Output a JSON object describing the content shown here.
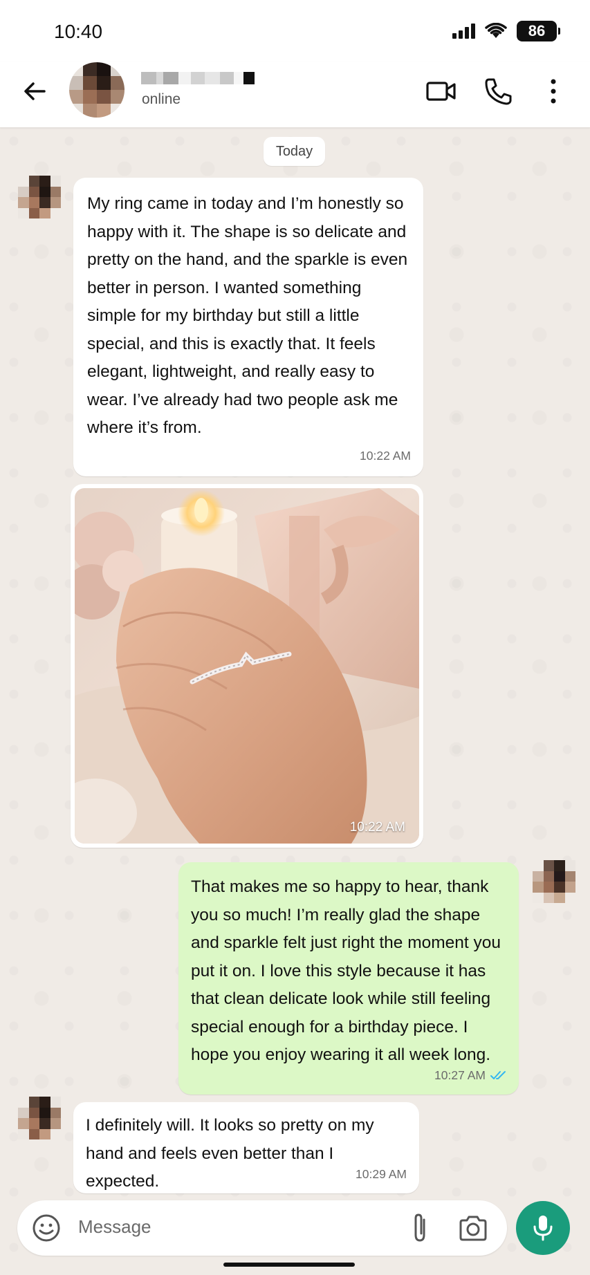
{
  "status_bar": {
    "time": "10:40",
    "battery": "86"
  },
  "header": {
    "contact_status": "online"
  },
  "date_chip": "Today",
  "messages": [
    {
      "direction": "in",
      "text": "My ring came in today and I’m honestly so happy with it. The shape is so delicate and pretty on the hand, and the sparkle is even better in person. I wanted something simple for my birthday but still a little special, and this is exactly that. It feels elegant, lightweight, and really easy to wear. I’ve already had two people ask me where it’s from.",
      "time": "10:22 AM"
    },
    {
      "direction": "in",
      "type": "image",
      "description_icon": "photo-ring-on-hand",
      "time": "10:22 AM"
    },
    {
      "direction": "out",
      "text": "That makes me so happy to hear, thank you so much! I’m really glad the shape and sparkle felt just right the moment you put it on. I love this style because it has that clean delicate look while still feeling special enough for a birthday piece. I hope you enjoy wearing it all week long.",
      "time": "10:27 AM",
      "read_status": "read"
    },
    {
      "direction": "in",
      "text": "I definitely will. It looks so pretty on my hand and feels even better than I expected.",
      "time": "10:29 AM"
    }
  ],
  "input": {
    "placeholder": "Message"
  },
  "colors": {
    "accent": "#1a9c7c",
    "outgoing_bubble": "#dcf8c6",
    "incoming_bubble": "#ffffff",
    "read_ticks": "#34b7f1"
  }
}
